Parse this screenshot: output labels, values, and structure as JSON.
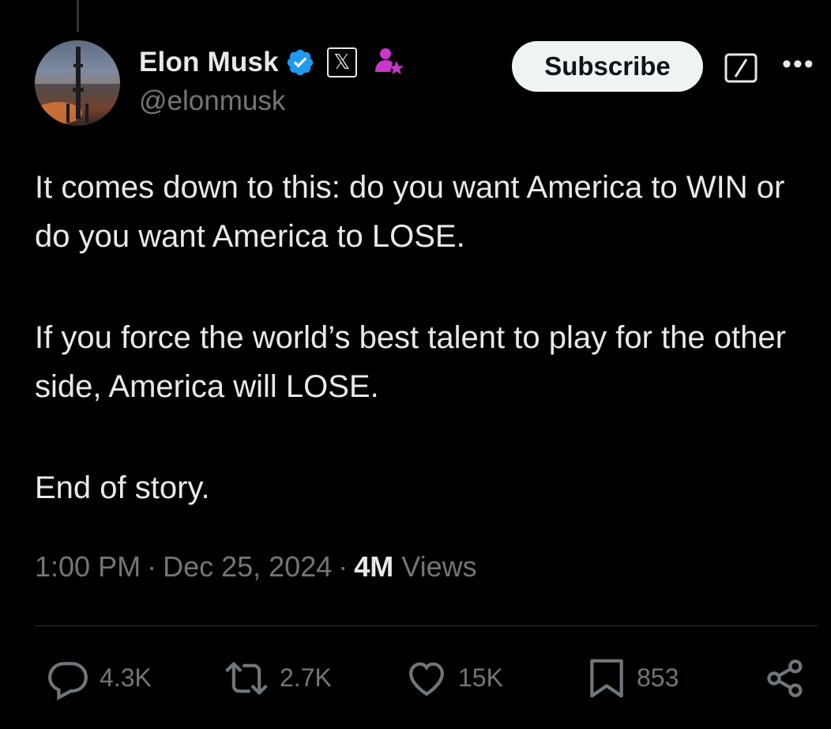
{
  "author": {
    "display_name": "Elon Musk",
    "handle": "@elonmusk",
    "verified_icon": "verified-badge-icon",
    "affiliation_badge": "𝕏",
    "subscriber_icon": "subscriber-star-icon"
  },
  "header": {
    "subscribe_label": "Subscribe",
    "grok_icon": "grok-icon",
    "more_label": "•••"
  },
  "tweet": {
    "paragraphs": [
      "It comes down to this: do you want America to WIN or do you want America to LOSE.",
      "If you force the world’s best talent to play for the other side, America will LOSE.",
      "End of story."
    ]
  },
  "meta": {
    "time": "1:00 PM",
    "separator": "·",
    "date": "Dec 25, 2024",
    "views_count": "4M",
    "views_label": "Views"
  },
  "actions": {
    "replies": "4.3K",
    "reposts": "2.7K",
    "likes": "15K",
    "bookmarks": "853"
  },
  "colors": {
    "background": "#000000",
    "text": "#e7e9ea",
    "secondary": "#71767b",
    "verified": "#1d9bf0",
    "subscriber": "#c936cc"
  }
}
